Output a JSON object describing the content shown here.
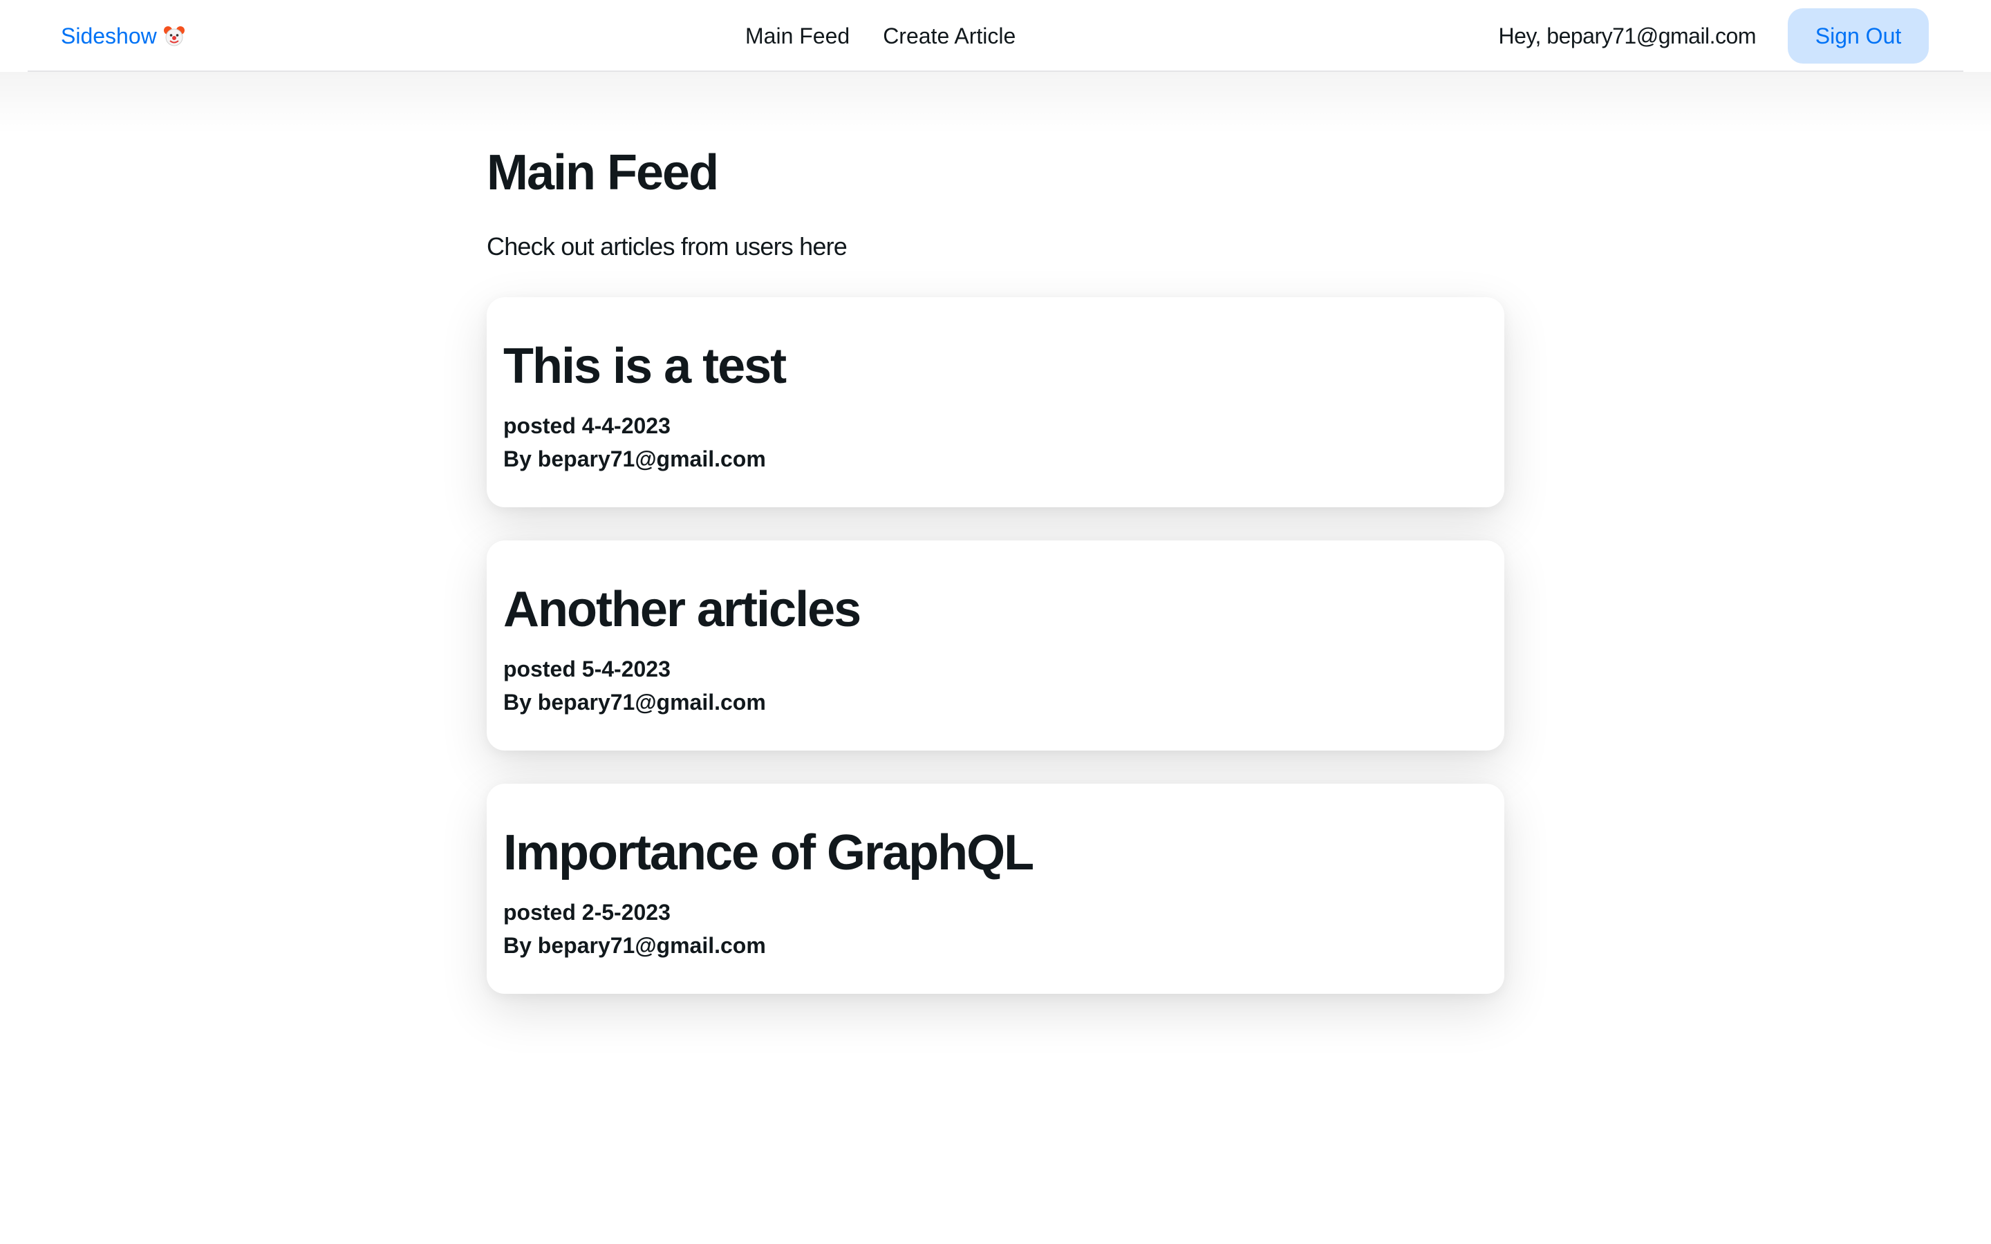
{
  "navbar": {
    "brand": "Sideshow",
    "brand_icon": "clown-face-icon",
    "links": [
      "Main Feed",
      "Create Article"
    ],
    "greeting": "Hey, bepary71@gmail.com",
    "signout_label": "Sign Out",
    "colors": {
      "brand": "#0072f5",
      "signout_bg": "#cee4fe"
    }
  },
  "main": {
    "title": "Main Feed",
    "subtitle": "Check out articles from users here",
    "articles": [
      {
        "title": "This is a test",
        "posted": "posted 4-4-2023",
        "author": "By bepary71@gmail.com"
      },
      {
        "title": "Another articles",
        "posted": "posted 5-4-2023",
        "author": "By bepary71@gmail.com"
      },
      {
        "title": "Importance of GraphQL",
        "posted": "posted 2-5-2023",
        "author": "By bepary71@gmail.com"
      }
    ]
  }
}
